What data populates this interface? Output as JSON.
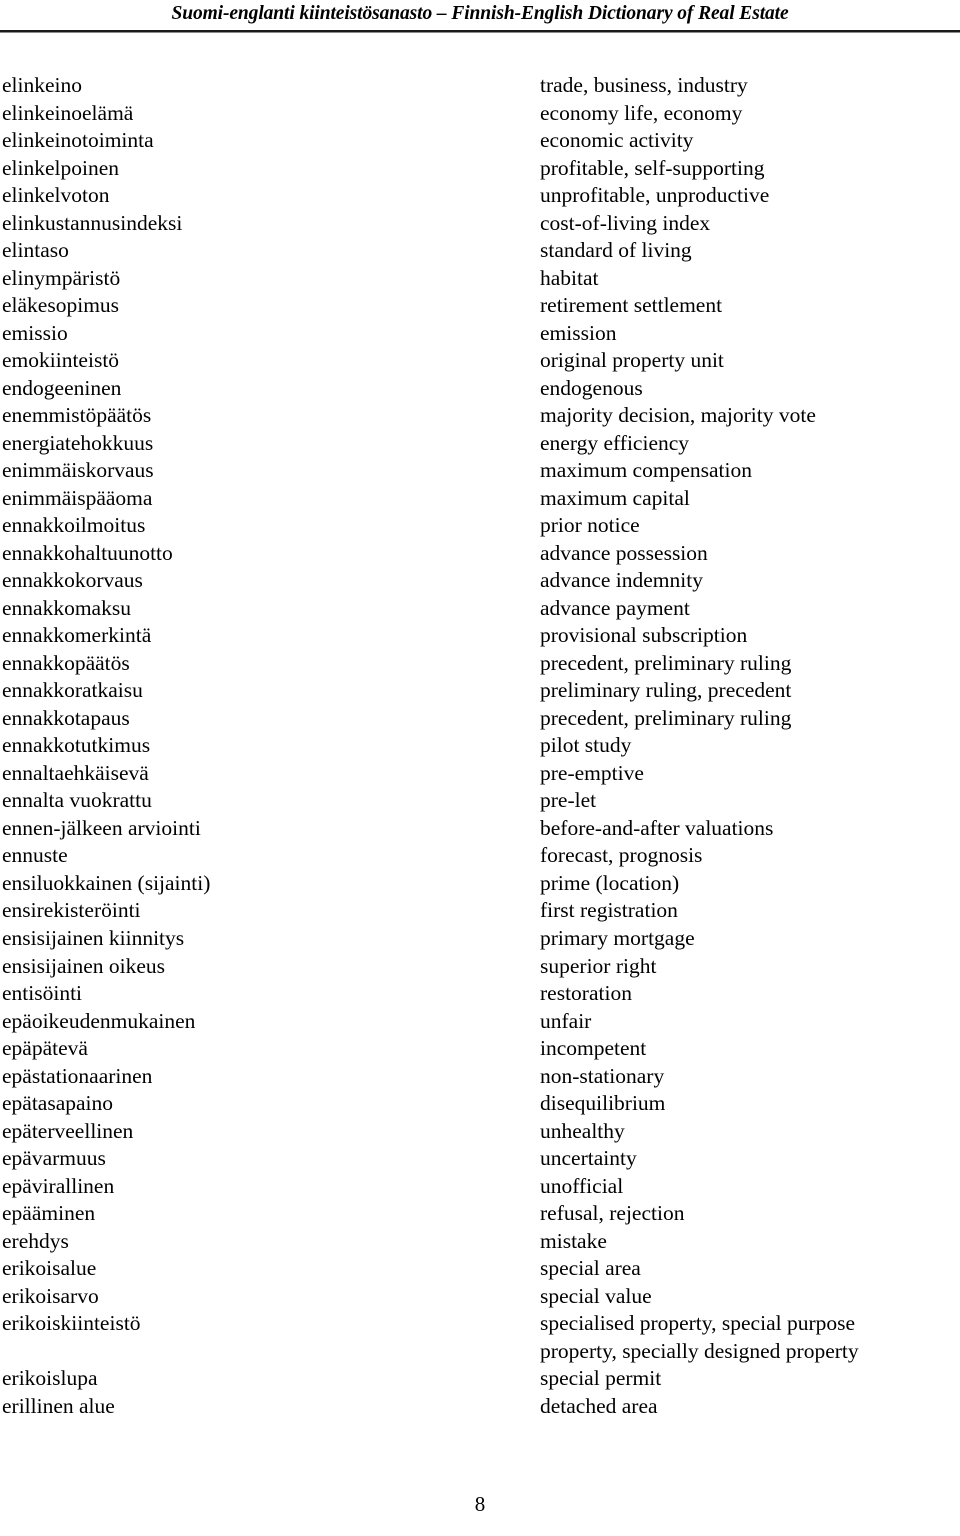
{
  "header": {
    "title": "Suomi-englanti kiinteistösanasto – Finnish-English Dictionary of Real Estate"
  },
  "footer": {
    "page_number": "8"
  },
  "colors": {
    "text": "#000000",
    "rule": "#1a1a1a",
    "background": "#ffffff"
  },
  "glossary": {
    "language_source": "Finnish",
    "language_target": "English",
    "entries": [
      {
        "term": "elinkeino",
        "definition": "trade, business, industry"
      },
      {
        "term": "elinkeinoelämä",
        "definition": "economy life, economy"
      },
      {
        "term": "elinkeinotoiminta",
        "definition": "economic activity"
      },
      {
        "term": "elinkelpoinen",
        "definition": "profitable, self-supporting"
      },
      {
        "term": "elinkelvoton",
        "definition": "unprofitable, unproductive"
      },
      {
        "term": "elinkustannusindeksi",
        "definition": "cost-of-living index"
      },
      {
        "term": "elintaso",
        "definition": "standard of living"
      },
      {
        "term": "elinympäristö",
        "definition": "habitat"
      },
      {
        "term": "eläkesopimus",
        "definition": "retirement settlement"
      },
      {
        "term": "emissio",
        "definition": "emission"
      },
      {
        "term": "emokiinteistö",
        "definition": "original property unit"
      },
      {
        "term": "endogeeninen",
        "definition": "endogenous"
      },
      {
        "term": "enemmistöpäätös",
        "definition": "majority decision, majority vote"
      },
      {
        "term": "energiatehokkuus",
        "definition": "energy efficiency"
      },
      {
        "term": "enimmäiskorvaus",
        "definition": "maximum compensation"
      },
      {
        "term": "enimmäispääoma",
        "definition": "maximum capital"
      },
      {
        "term": "ennakkoilmoitus",
        "definition": "prior notice"
      },
      {
        "term": "ennakkohaltuunotto",
        "definition": "advance possession"
      },
      {
        "term": "ennakkokorvaus",
        "definition": "advance indemnity"
      },
      {
        "term": "ennakkomaksu",
        "definition": "advance payment"
      },
      {
        "term": "ennakkomerkintä",
        "definition": "provisional subscription"
      },
      {
        "term": "ennakkopäätös",
        "definition": "precedent, preliminary ruling"
      },
      {
        "term": "ennakkoratkaisu",
        "definition": "preliminary ruling, precedent"
      },
      {
        "term": "ennakkotapaus",
        "definition": "precedent, preliminary ruling"
      },
      {
        "term": "ennakkotutkimus",
        "definition": "pilot study"
      },
      {
        "term": "ennaltaehkäisevä",
        "definition": "pre-emptive"
      },
      {
        "term": "ennalta vuokrattu",
        "definition": "pre-let"
      },
      {
        "term": "ennen-jälkeen arviointi",
        "definition": "before-and-after valuations"
      },
      {
        "term": "ennuste",
        "definition": "forecast, prognosis"
      },
      {
        "term": "ensiluokkainen (sijainti)",
        "definition": "prime (location)"
      },
      {
        "term": "ensirekisteröinti",
        "definition": "first registration"
      },
      {
        "term": "ensisijainen kiinnitys",
        "definition": "primary mortgage"
      },
      {
        "term": "ensisijainen oikeus",
        "definition": "superior right"
      },
      {
        "term": "entisöinti",
        "definition": "restoration"
      },
      {
        "term": "epäoikeudenmukainen",
        "definition": "unfair"
      },
      {
        "term": "epäpätevä",
        "definition": "incompetent"
      },
      {
        "term": "epästationaarinen",
        "definition": "non-stationary"
      },
      {
        "term": "epätasapaino",
        "definition": "disequilibrium"
      },
      {
        "term": "epäterveellinen",
        "definition": "unhealthy"
      },
      {
        "term": "epävarmuus",
        "definition": "uncertainty"
      },
      {
        "term": "epävirallinen",
        "definition": "unofficial"
      },
      {
        "term": "epääminen",
        "definition": "refusal, rejection"
      },
      {
        "term": "erehdys",
        "definition": "mistake"
      },
      {
        "term": "erikoisalue",
        "definition": "special area"
      },
      {
        "term": "erikoisarvo",
        "definition": "special value"
      },
      {
        "term": "erikoiskiinteistö",
        "definition": "specialised property, special purpose"
      },
      {
        "term": "",
        "definition": "property, specially designed property"
      },
      {
        "term": "erikoislupa",
        "definition": "special permit"
      },
      {
        "term": "erillinen alue",
        "definition": "detached area"
      }
    ]
  }
}
